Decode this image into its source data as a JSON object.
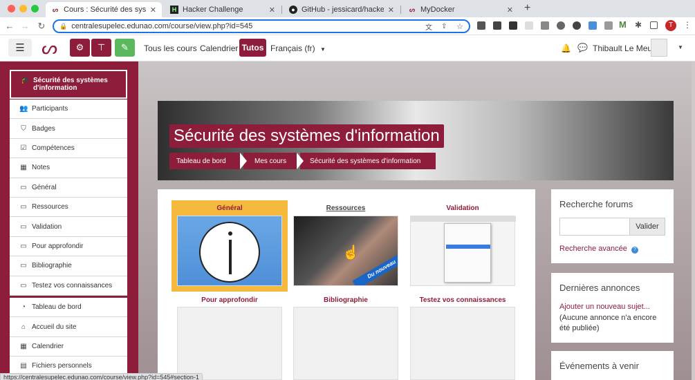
{
  "browser": {
    "tabs": [
      {
        "title": "Cours : Sécurité des systèmes",
        "active": true
      },
      {
        "title": "Hacker Challenge",
        "active": false
      },
      {
        "title": "GitHub - jessicard/hacker-chal",
        "active": false
      },
      {
        "title": "MyDocker",
        "active": false
      }
    ],
    "new_tab": "+",
    "url": "centralesupelec.edunao.com/course/view.php?id=545",
    "profile_initial": "T",
    "status_url": "https://centralesupelec.edunao.com/course/view.php?id=545#section-1"
  },
  "navbar": {
    "links": [
      "Tous les cours",
      "Calendrier"
    ],
    "active_link": "Tutos",
    "language": "Français (fr)",
    "user_name": "Thibault Le Meur"
  },
  "drawer": {
    "course_title": "Sécurité des systèmes d'information",
    "course_items": [
      {
        "label": "Participants",
        "icon": "users-icon"
      },
      {
        "label": "Badges",
        "icon": "shield-icon"
      },
      {
        "label": "Compétences",
        "icon": "checkbox-icon"
      },
      {
        "label": "Notes",
        "icon": "table-icon"
      },
      {
        "label": "Général",
        "icon": "folder-icon"
      },
      {
        "label": "Ressources",
        "icon": "folder-icon"
      },
      {
        "label": "Validation",
        "icon": "folder-icon"
      },
      {
        "label": "Pour approfondir",
        "icon": "folder-icon"
      },
      {
        "label": "Bibliographie",
        "icon": "folder-icon"
      },
      {
        "label": "Testez vos connaissances",
        "icon": "folder-icon"
      }
    ],
    "site_items": [
      {
        "label": "Tableau de bord",
        "icon": "dashboard-icon"
      },
      {
        "label": "Accueil du site",
        "icon": "home-icon"
      },
      {
        "label": "Calendrier",
        "icon": "calendar-icon"
      },
      {
        "label": "Fichiers personnels",
        "icon": "file-icon"
      }
    ]
  },
  "header": {
    "title": "Sécurité des systèmes d'information",
    "breadcrumb": [
      "Tableau de bord",
      "Mes cours",
      "Sécurité des systèmes d'information"
    ]
  },
  "sections": [
    {
      "title": "Général"
    },
    {
      "title": "Ressources",
      "badge": "Du nouveau"
    },
    {
      "title": "Validation"
    },
    {
      "title": "Pour approfondir"
    },
    {
      "title": "Bibliographie"
    },
    {
      "title": "Testez vos connaissances"
    }
  ],
  "blocks": {
    "search": {
      "title": "Recherche forums",
      "button": "Valider",
      "advanced": "Recherche avancée"
    },
    "news": {
      "title": "Dernières annonces",
      "add": "Ajouter un nouveau sujet...",
      "empty": "(Aucune annonce n'a encore été publiée)"
    },
    "events": {
      "title": "Événements à venir"
    }
  },
  "colors": {
    "brand": "#8d1d3a",
    "green": "#5cb85c",
    "highlight": "#f5b93e"
  }
}
